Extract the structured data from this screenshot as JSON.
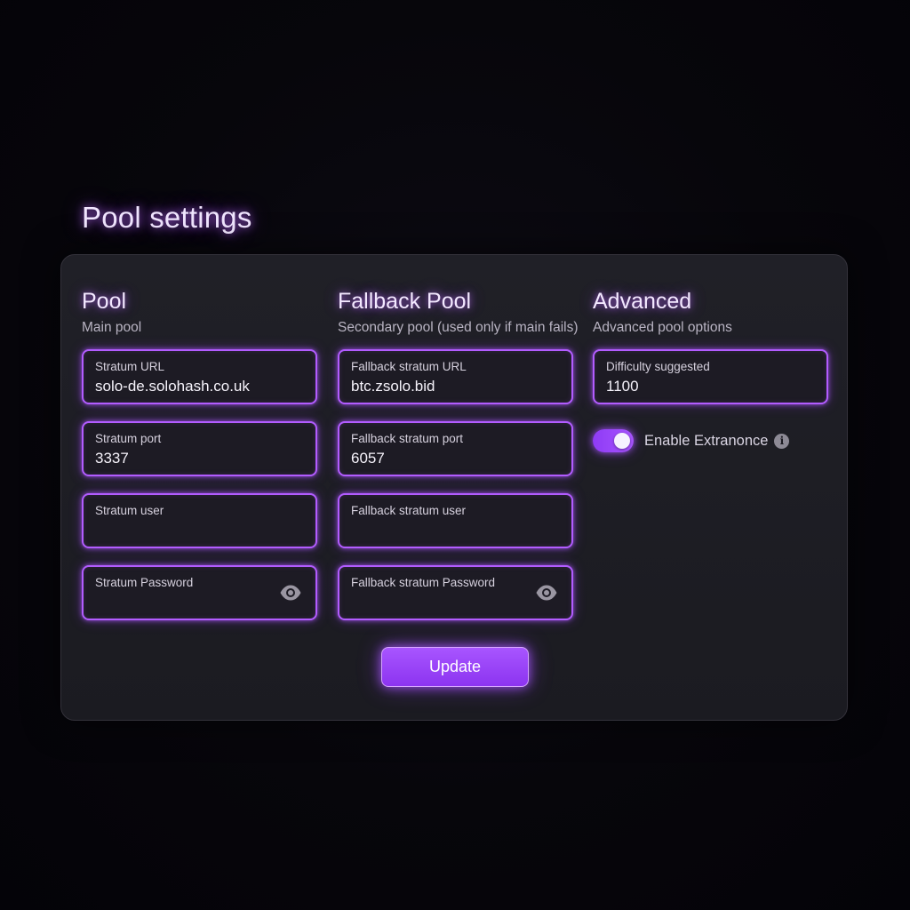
{
  "page_title": "Pool settings",
  "pool": {
    "title": "Pool",
    "subtitle": "Main pool",
    "fields": [
      {
        "label": "Stratum URL",
        "value": "solo-de.solohash.co.uk"
      },
      {
        "label": "Stratum port",
        "value": "3337"
      },
      {
        "label": "Stratum user",
        "value": ""
      },
      {
        "label": "Stratum Password",
        "value": ""
      }
    ]
  },
  "fallback": {
    "title": "Fallback Pool",
    "subtitle": "Secondary pool (used only if main fails)",
    "fields": [
      {
        "label": "Fallback stratum URL",
        "value": "btc.zsolo.bid"
      },
      {
        "label": "Fallback stratum port",
        "value": "6057"
      },
      {
        "label": "Fallback stratum user",
        "value": ""
      },
      {
        "label": "Fallback stratum Password",
        "value": ""
      }
    ]
  },
  "advanced": {
    "title": "Advanced",
    "subtitle": "Advanced pool options",
    "difficulty": {
      "label": "Difficulty suggested",
      "value": "1100"
    },
    "extranonce": {
      "label": "Enable Extranonce",
      "enabled": true
    }
  },
  "actions": {
    "update_label": "Update"
  },
  "icons": {
    "password_toggle": "eye-icon",
    "info": "info-icon"
  },
  "colors": {
    "accent": "#a855ff",
    "border_glow": "#b25cff",
    "card_bg": "#1e1e25",
    "page_bg": "#07060b"
  }
}
